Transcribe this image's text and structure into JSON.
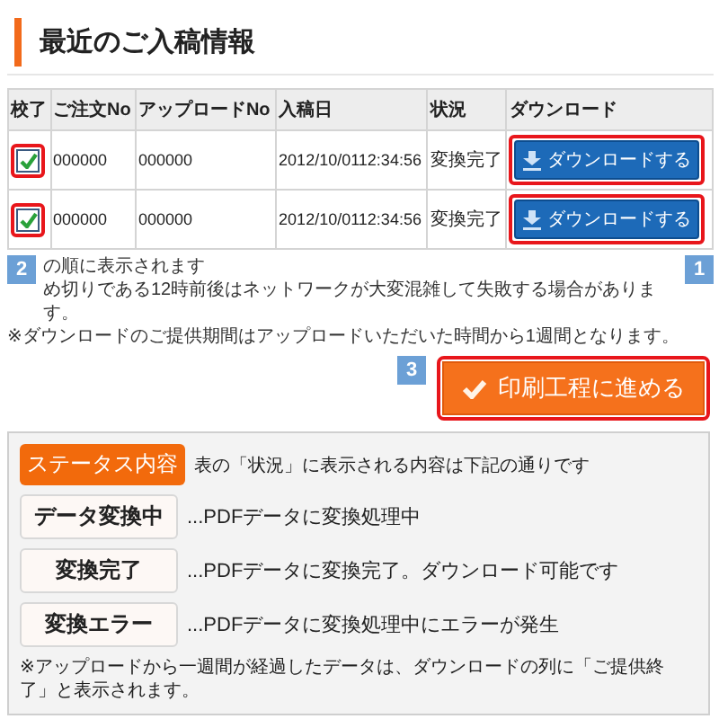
{
  "heading": "最近のご入稿情報",
  "table": {
    "columns": [
      "校了",
      "ご注文No",
      "アップロードNo",
      "入稿日",
      "状況",
      "ダウンロード"
    ],
    "rows": [
      {
        "checked": true,
        "order_no": "000000",
        "upload_no": "000000",
        "date": "2012/10/0112:34:56",
        "status": "変換完了",
        "download": "ダウンロードする"
      },
      {
        "checked": true,
        "order_no": "000000",
        "upload_no": "000000",
        "date": "2012/10/0112:34:56",
        "status": "変換完了",
        "download": "ダウンロードする"
      }
    ]
  },
  "download_marker": "1",
  "notes": {
    "marker": "2",
    "lines": [
      "の順に表示されます",
      "め切りである12時前後はネットワークが大変混雑して失敗する場合があります。"
    ],
    "footnote": "※ダウンロードのご提供期間はアップロードいただいた時間から1週間となります。"
  },
  "proceed": {
    "marker": "3",
    "label": "印刷工程に進める"
  },
  "status_legend": {
    "badge": "ステータス内容",
    "intro": "表の「状況」に表示される内容は下記の通りです",
    "items": [
      {
        "label": "データ変換中",
        "text": "...PDFデータに変換処理中"
      },
      {
        "label": "変換完了",
        "text": "...PDFデータに変換完了。ダウンロード可能です"
      },
      {
        "label": "変換エラー",
        "text": "...PDFデータに変換処理中にエラーが発生"
      }
    ],
    "note": "※アップロードから一週間が経過したデータは、ダウンロードの列に「ご提供終了」と表示されます。"
  }
}
